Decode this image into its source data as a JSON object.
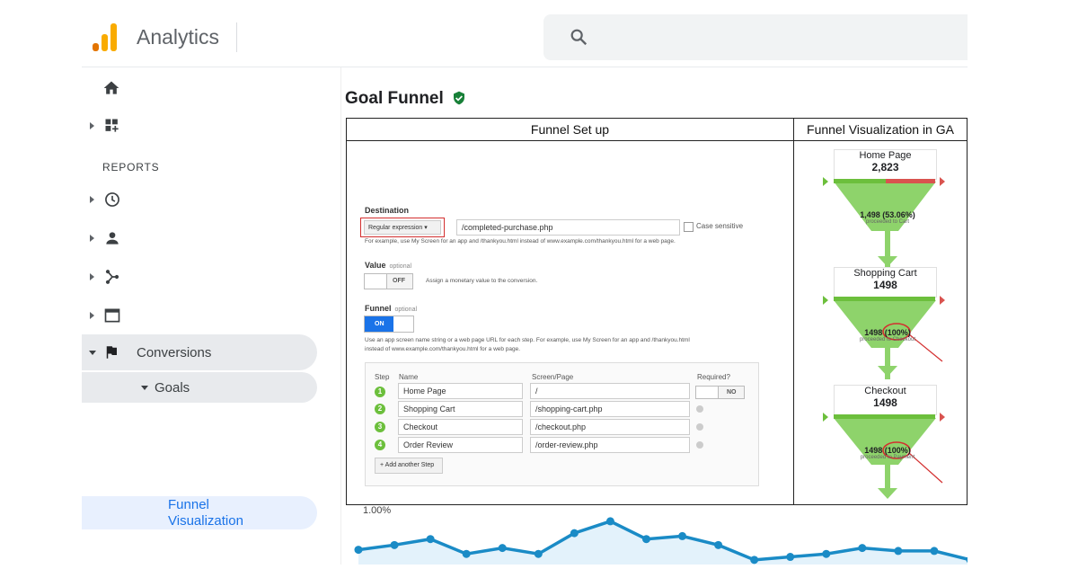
{
  "app": {
    "title": "Analytics",
    "search_placeholder": ""
  },
  "sidebar": {
    "reports_label": "REPORTS",
    "conversions_label": "Conversions",
    "goals_label": "Goals",
    "funnel_label_line1": "Funnel",
    "funnel_label_line2": "Visualization"
  },
  "main": {
    "title": "Goal Funnel",
    "setup_heading": "Funnel Set up",
    "viz_heading": "Funnel Visualization in GA"
  },
  "setup": {
    "destination_label": "Destination",
    "match_type": "Regular expression",
    "destination_value": "/completed-purchase.php",
    "case_sensitive_label": "Case sensitive",
    "destination_hint": "For example, use My Screen for an app and /thankyou.html instead of www.example.com/thankyou.html for a web page.",
    "value_label": "Value",
    "optional": "optional",
    "value_toggle": "OFF",
    "value_hint": "Assign a monetary value to the conversion.",
    "funnel_label": "Funnel",
    "funnel_toggle": "ON",
    "funnel_hint_line1": "Use an app screen name string or a web page URL for each step. For example, use My Screen for an app and /thankyou.html",
    "funnel_hint_line2": "instead of www.example.com/thankyou.html for a web page.",
    "col_step": "Step",
    "col_name": "Name",
    "col_screen": "Screen/Page",
    "col_required": "Required?",
    "required_toggle": "NO",
    "steps": [
      {
        "num": "1",
        "name": "Home Page",
        "page": "/"
      },
      {
        "num": "2",
        "name": "Shopping Cart",
        "page": "/shopping-cart.php"
      },
      {
        "num": "3",
        "name": "Checkout",
        "page": "/checkout.php"
      },
      {
        "num": "4",
        "name": "Order Review",
        "page": "/order-review.php"
      }
    ],
    "add_step": "+ Add another Step"
  },
  "funnel_viz": {
    "stages": [
      {
        "name": "Home Page",
        "value": "2,823"
      },
      {
        "name": "Shopping Cart",
        "value": "1498"
      },
      {
        "name": "Checkout",
        "value": "1498"
      }
    ],
    "transitions": [
      {
        "value": "1,498 (53.06%)",
        "caption": "proceeded to Cart"
      },
      {
        "value": "1498 (100%)",
        "caption": "proceeded to Checkout"
      },
      {
        "value": "1498 (100%)",
        "caption": "proceeded to Payment"
      }
    ]
  },
  "chart_data": {
    "type": "line",
    "ytick_label": "1.00%",
    "color": "#1a8bc6",
    "values": [
      40,
      48,
      58,
      33,
      43,
      33,
      68,
      88,
      58,
      63,
      48,
      23,
      28,
      33,
      43,
      38,
      38,
      23
    ]
  },
  "colors": {
    "green": "#6cbf3c",
    "red": "#d9534f",
    "blue": "#1a73e8",
    "orange": "#f9ab00"
  }
}
